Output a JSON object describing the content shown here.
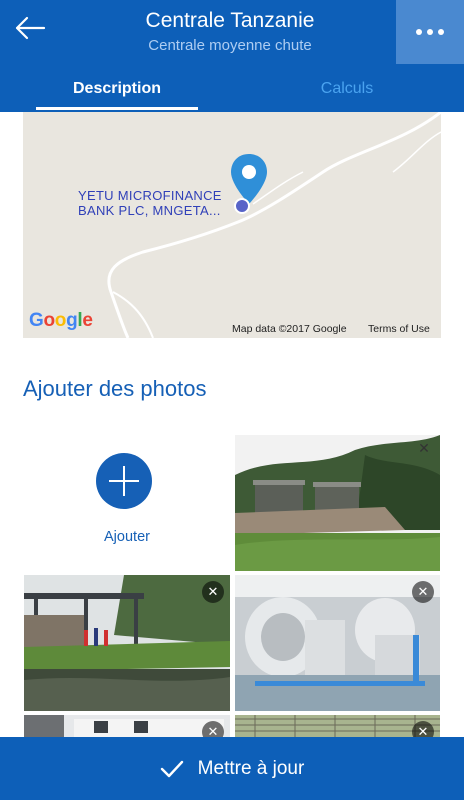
{
  "header": {
    "title": "Centrale Tanzanie",
    "subtitle": "Centrale moyenne chute",
    "back_icon": "arrow-left-icon",
    "more_icon": "more-horizontal-icon"
  },
  "tabs": [
    {
      "label": "Description",
      "active": true
    },
    {
      "label": "Calculs",
      "active": false
    }
  ],
  "map": {
    "place_label_line1": "YETU MICROFINANCE",
    "place_label_line2": "BANK PLC, MNGETA...",
    "logo": "Google",
    "attribution": "Map data ©2017 Google",
    "terms": "Terms of Use",
    "pin_color": "#2f8fd8"
  },
  "photos_section": {
    "title": "Ajouter des photos",
    "add_label": "Ajouter",
    "remove_glyph": "✕"
  },
  "bottom_bar": {
    "label": "Mettre à jour",
    "icon": "check-icon"
  },
  "colors": {
    "primary": "#0d5fb8",
    "accent_tab": "#4aa3f0",
    "section_title": "#1660b6"
  }
}
